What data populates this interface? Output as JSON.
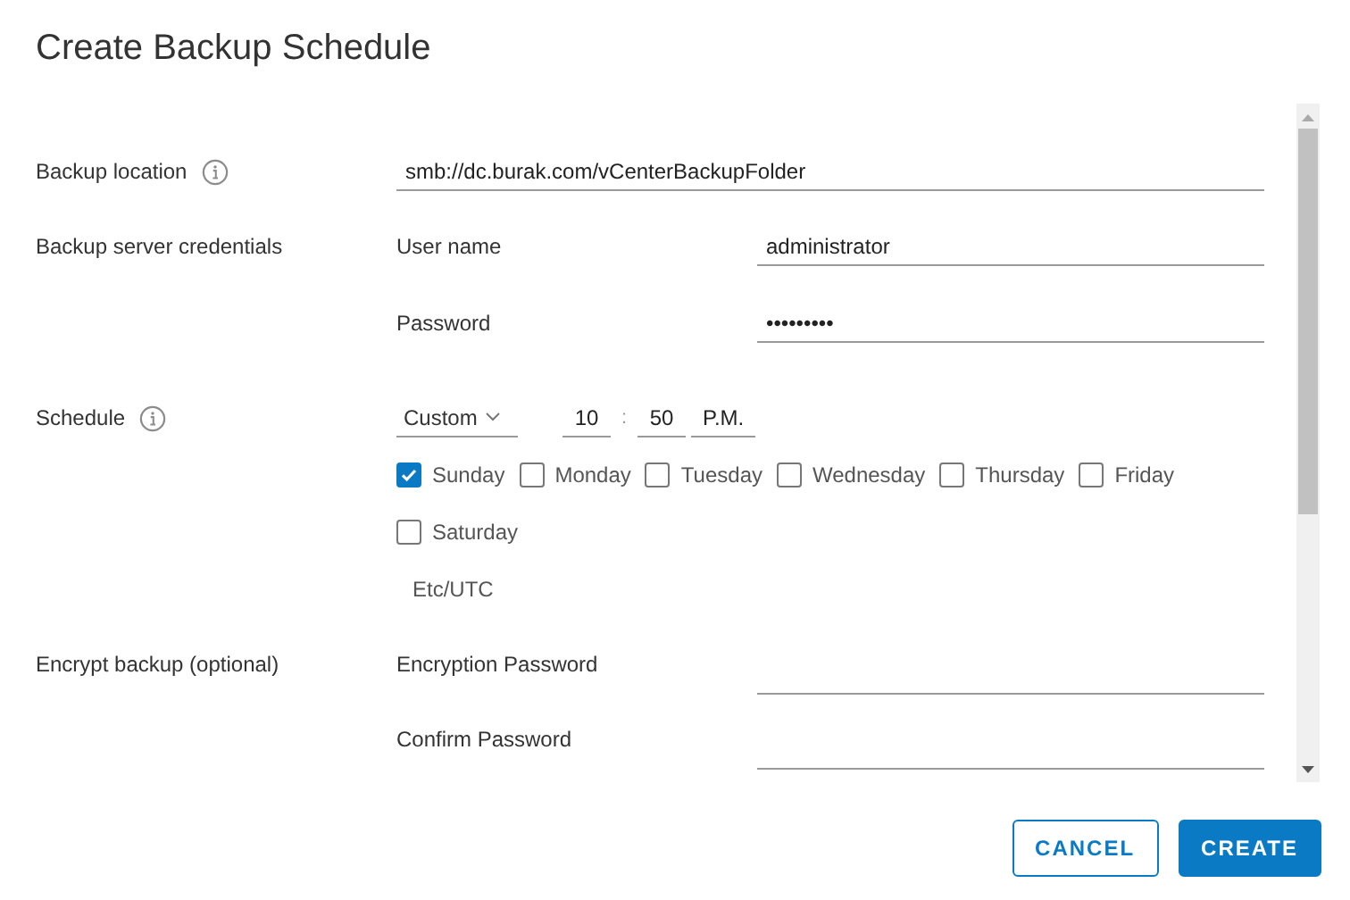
{
  "dialog": {
    "title": "Create Backup Schedule"
  },
  "backup_location": {
    "label": "Backup location",
    "value": "smb://dc.burak.com/vCenterBackupFolder"
  },
  "credentials": {
    "label": "Backup server credentials",
    "fields": [
      {
        "label": "User name",
        "value": "administrator"
      },
      {
        "label": "Password",
        "value": "•••••••••"
      }
    ]
  },
  "schedule": {
    "label": "Schedule",
    "frequency": "Custom",
    "hour": "10",
    "separator": ":",
    "minute": "50",
    "period": "P.M.",
    "timezone": "Etc/UTC",
    "days": [
      {
        "label": "Sunday",
        "checked": true
      },
      {
        "label": "Monday",
        "checked": false
      },
      {
        "label": "Tuesday",
        "checked": false
      },
      {
        "label": "Wednesday",
        "checked": false
      },
      {
        "label": "Thursday",
        "checked": false
      },
      {
        "label": "Friday",
        "checked": false
      },
      {
        "label": "Saturday",
        "checked": false
      }
    ]
  },
  "encryption": {
    "label": "Encrypt backup (optional)",
    "fields": [
      {
        "label": "Encryption Password"
      },
      {
        "label": "Confirm Password"
      }
    ]
  },
  "buttons": [
    {
      "label": "CANCEL",
      "kind": "secondary"
    },
    {
      "label": "CREATE",
      "kind": "primary"
    }
  ]
}
